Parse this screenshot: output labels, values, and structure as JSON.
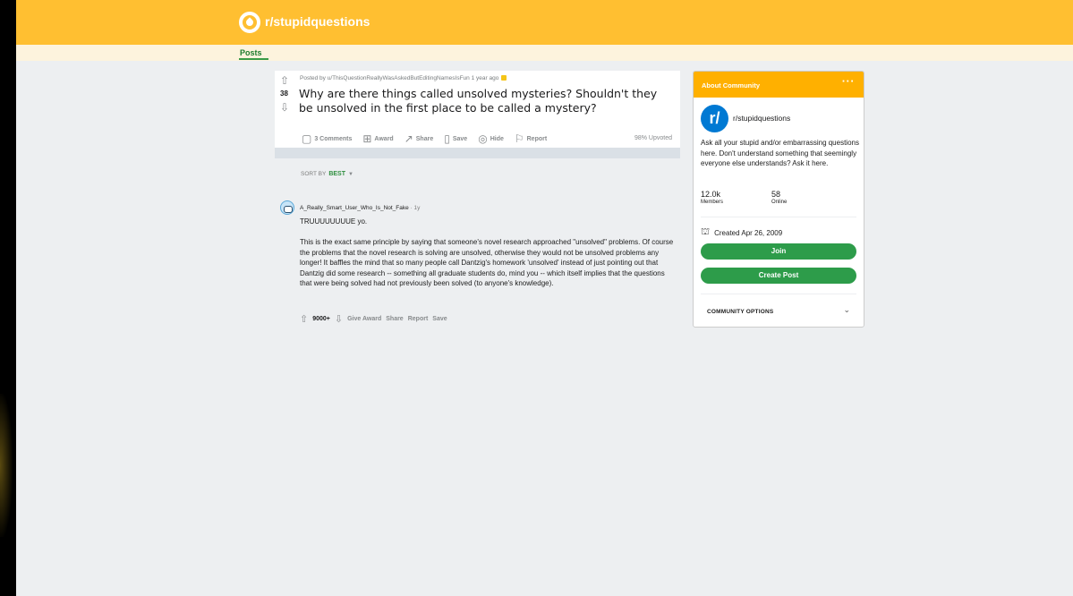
{
  "header": {
    "subreddit": "r/stupidquestions",
    "nav_posts": "Posts",
    "brand_color": "#ffbf31"
  },
  "post": {
    "score": "38",
    "meta": "Posted by u/ThisQuestionReallyWasAskedButEditingNamesIsFun 1 year ago",
    "title": "Why are there things called unsolved mysteries? Shouldn't they be unsolved in the first place to be called a mystery?",
    "actions": {
      "comments": "3 Comments",
      "award": "Award",
      "share": "Share",
      "save": "Save",
      "hide": "Hide",
      "report": "Report"
    },
    "upvoted": "98% Upvoted"
  },
  "sort": {
    "label": "SORT BY",
    "value": "BEST"
  },
  "comment": {
    "author": "A_Really_Smart_User_Who_Is_Not_Fake",
    "age": "1y",
    "lead": "TRUUUUUUUUE yo.",
    "body": "This is the exact same principle by saying that someone's novel research approached \"unsolved\" problems. Of course the problems that the novel research is solving are unsolved, otherwise they would not be unsolved problems any longer! It baffles the mind that so many people call Dantzig's homework 'unsolved' instead of just pointing out that Dantzig did some research -- something all graduate students do, mind you -- which itself implies that the questions that were being solved had not previously been solved (to anyone's knowledge).",
    "score": "9000+",
    "actions": {
      "give_award": "Give Award",
      "share": "Share",
      "report": "Report",
      "save": "Save"
    }
  },
  "sidebar": {
    "title": "About Community",
    "dots": "···",
    "logo_text": "r/",
    "name": "r/stupidquestions",
    "description": "Ask all your stupid and/or embarrassing questions here. Don't understand something that seemingly everyone else understands? Ask it here.",
    "members_count": "12.0k",
    "members_label": "Members",
    "online_count": "58",
    "online_label": "Online",
    "created": "Created Apr 26, 2009",
    "join_label": "Join",
    "create_post_label": "Create Post",
    "options_label": "COMMUNITY OPTIONS",
    "accent_color": "#ffb000",
    "button_color": "#2d9c4a"
  }
}
